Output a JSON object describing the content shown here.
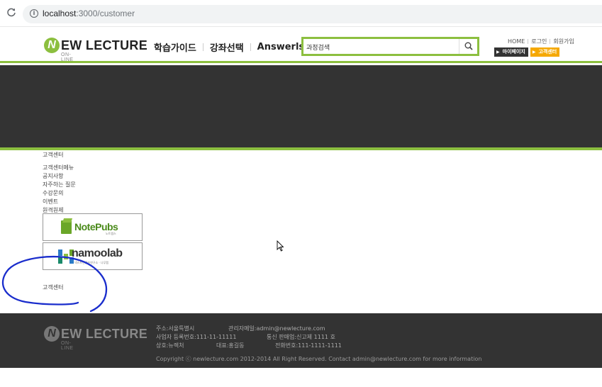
{
  "browser": {
    "url_host": "localhost",
    "url_path": ":3000/customer"
  },
  "header": {
    "logo_main": "EW LECTURE",
    "logo_n": "N",
    "logo_sub": "ON-LINE",
    "nav": [
      "학습가이드",
      "강좌선택",
      "Answerls"
    ],
    "search_value": "과정검색",
    "top_links": [
      "HOME",
      "로그인",
      "회원가입"
    ],
    "quick": [
      "마이페이지",
      "고객센터"
    ]
  },
  "content": {
    "cs_title": "고객센터",
    "menu": [
      "고객센터메뉴",
      "공지사항",
      "자주하는 질문",
      "수강문의",
      "이벤트",
      "원격원제"
    ],
    "banners": {
      "notepubs": "NotePubs",
      "notepubs_sub": "노트펍스",
      "namoolab_a": "namoo",
      "namoolab_b": "lab",
      "namoolab_sub": "넥스트컨텐츠연구소 · 나무랩"
    },
    "cs_bottom": "고객센터"
  },
  "footer": {
    "logo_main": "EW LECTURE",
    "logo_n": "N",
    "logo_sub": "ON-LINE",
    "address": "주소:서울특별시",
    "admin_email": "관리자메일:admin@newlecture.com",
    "biz_number": "사업자 등록번호:111-11-11111",
    "mail_order": "통신 판매업:신고제 1111 호",
    "company": "상호:뉴렉처",
    "ceo": "대표:홍길동",
    "phone": "전화번호:111-1111-1111",
    "copyright": "Copyright ⓒ newlecture.com 2012-2014 All Right Reserved. Contact admin@newlecture.com for more information"
  },
  "colors": {
    "accent": "#8cbf3f",
    "banner": "#333333",
    "orange": "#f5a800",
    "annotation": "#1a2dcc"
  }
}
